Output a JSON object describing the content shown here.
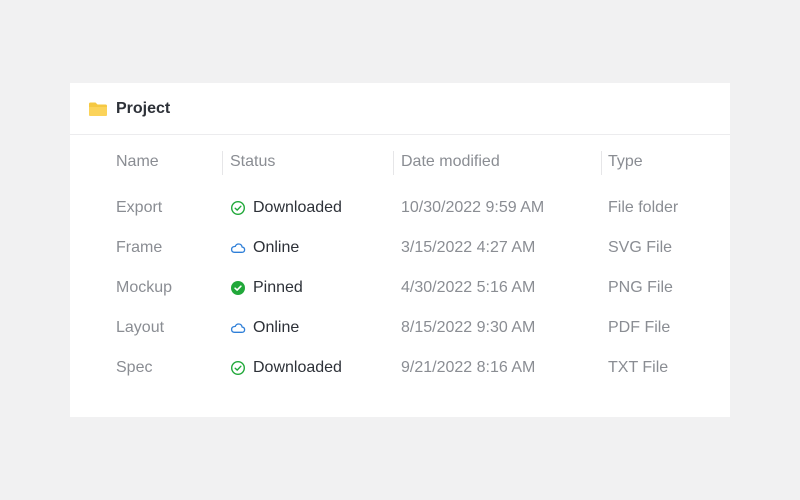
{
  "panel": {
    "title": "Project",
    "icon": "folder-icon",
    "folder_color": "#f5c842"
  },
  "table": {
    "columns": {
      "name": "Name",
      "status": "Status",
      "date": "Date modified",
      "type": "Type"
    },
    "rows": [
      {
        "name": "Export",
        "status": "Downloaded",
        "status_icon": "check-circle-outline-icon",
        "date": "10/30/2022 9:59 AM",
        "type": "File folder"
      },
      {
        "name": "Frame",
        "status": "Online",
        "status_icon": "cloud-icon",
        "date": "3/15/2022 4:27 AM",
        "type": "SVG File"
      },
      {
        "name": "Mockup",
        "status": "Pinned",
        "status_icon": "check-circle-filled-icon",
        "date": "4/30/2022 5:16 AM",
        "type": "PNG File"
      },
      {
        "name": "Layout",
        "status": "Online",
        "status_icon": "cloud-icon",
        "date": "8/15/2022 9:30 AM",
        "type": "PDF File"
      },
      {
        "name": "Spec",
        "status": "Downloaded",
        "status_icon": "check-circle-outline-icon",
        "date": "9/21/2022 8:16 AM",
        "type": "TXT File"
      }
    ]
  },
  "colors": {
    "green": "#21a83a",
    "blue": "#2f7fd8"
  }
}
